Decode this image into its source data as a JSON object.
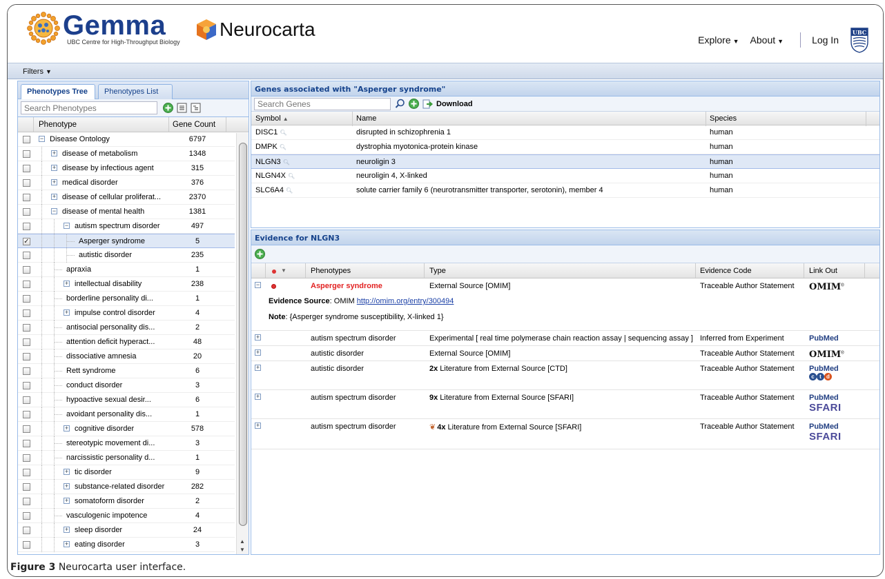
{
  "header": {
    "gemma_title": "Gemma",
    "gemma_subtitle": "UBC Centre for High-Throughput Biology",
    "neurocarta_title": "Neurocarta",
    "nav": {
      "explore": "Explore",
      "about": "About",
      "login": "Log In"
    },
    "ubc_logo_text": "UBC"
  },
  "filters_label": "Filters",
  "left": {
    "tabs": {
      "tree": "Phenotypes Tree",
      "list": "Phenotypes List"
    },
    "search_placeholder": "Search Phenotypes",
    "col_phenotype": "Phenotype",
    "col_count": "Gene Count",
    "rows": [
      {
        "label": "Disease Ontology",
        "count": "6797",
        "checked": false
      },
      {
        "label": "disease of metabolism",
        "count": "1348",
        "checked": false
      },
      {
        "label": "disease by infectious agent",
        "count": "315",
        "checked": false
      },
      {
        "label": "medical disorder",
        "count": "376",
        "checked": false
      },
      {
        "label": "disease of cellular proliferat...",
        "count": "2370",
        "checked": false
      },
      {
        "label": "disease of mental health",
        "count": "1381",
        "checked": false
      },
      {
        "label": "autism spectrum disorder",
        "count": "497",
        "checked": false
      },
      {
        "label": "Asperger syndrome",
        "count": "5",
        "checked": true
      },
      {
        "label": "autistic disorder",
        "count": "235",
        "checked": false
      },
      {
        "label": "apraxia",
        "count": "1",
        "checked": false
      },
      {
        "label": "intellectual disability",
        "count": "238",
        "checked": false
      },
      {
        "label": "borderline personality di...",
        "count": "1",
        "checked": false
      },
      {
        "label": "impulse control disorder",
        "count": "4",
        "checked": false
      },
      {
        "label": "antisocial personality dis...",
        "count": "2",
        "checked": false
      },
      {
        "label": "attention deficit hyperact...",
        "count": "48",
        "checked": false
      },
      {
        "label": "dissociative amnesia",
        "count": "20",
        "checked": false
      },
      {
        "label": "Rett syndrome",
        "count": "6",
        "checked": false
      },
      {
        "label": "conduct disorder",
        "count": "3",
        "checked": false
      },
      {
        "label": "hypoactive sexual desir...",
        "count": "6",
        "checked": false
      },
      {
        "label": "avoidant personality dis...",
        "count": "1",
        "checked": false
      },
      {
        "label": "cognitive disorder",
        "count": "578",
        "checked": false
      },
      {
        "label": "stereotypic movement di...",
        "count": "3",
        "checked": false
      },
      {
        "label": "narcissistic personality d...",
        "count": "1",
        "checked": false
      },
      {
        "label": "tic disorder",
        "count": "9",
        "checked": false
      },
      {
        "label": "substance-related disorder",
        "count": "282",
        "checked": false
      },
      {
        "label": "somatoform disorder",
        "count": "2",
        "checked": false
      },
      {
        "label": "vasculogenic impotence",
        "count": "4",
        "checked": false
      },
      {
        "label": "sleep disorder",
        "count": "24",
        "checked": false
      },
      {
        "label": "eating disorder",
        "count": "3",
        "checked": false
      }
    ]
  },
  "genes": {
    "title": "Genes associated with \"Asperger syndrome\"",
    "search_placeholder": "Search Genes",
    "download_label": "Download",
    "columns": {
      "symbol": "Symbol",
      "name": "Name",
      "species": "Species"
    },
    "rows": [
      {
        "symbol": "DISC1",
        "name": "disrupted in schizophrenia 1",
        "species": "human"
      },
      {
        "symbol": "DMPK",
        "name": "dystrophia myotonica-protein kinase",
        "species": "human"
      },
      {
        "symbol": "NLGN3",
        "name": "neuroligin 3",
        "species": "human"
      },
      {
        "symbol": "NLGN4X",
        "name": "neuroligin 4, X-linked",
        "species": "human"
      },
      {
        "symbol": "SLC6A4",
        "name": "solute carrier family 6 (neurotransmitter transporter, serotonin), member 4",
        "species": "human"
      }
    ]
  },
  "evidence": {
    "title": "Evidence for NLGN3",
    "columns": {
      "phenotypes": "Phenotypes",
      "type": "Type",
      "code": "Evidence Code",
      "link": "Link Out"
    },
    "expanded": {
      "source_label": "Evidence Source",
      "source_text": ": OMIM ",
      "source_link": "http://omim.org/entry/300494",
      "note_label": "Note",
      "note_text": ": {Asperger syndrome susceptibility, X-linked 1}"
    },
    "rows": [
      {
        "phenotype": "Asperger syndrome",
        "count_prefix": "",
        "type": "External Source [OMIM]",
        "code": "Traceable Author Statement",
        "link": "OMIM"
      },
      {
        "phenotype": "autism spectrum disorder",
        "count_prefix": "",
        "type": "Experimental [ real time polymerase chain reaction assay | sequencing assay ]",
        "code": "Inferred from Experiment",
        "link": "PubMed"
      },
      {
        "phenotype": "autistic disorder",
        "count_prefix": "",
        "type": "External Source [OMIM]",
        "code": "Traceable Author Statement",
        "link": "OMIM"
      },
      {
        "phenotype": "autistic disorder",
        "count_prefix": "2x",
        "type": " Literature from External Source [CTD]",
        "code": "Traceable Author Statement",
        "link": "PubMed"
      },
      {
        "phenotype": "autism spectrum disorder",
        "count_prefix": "9x",
        "type": " Literature from External Source [SFARI]",
        "code": "Traceable Author Statement",
        "link": "PubMed"
      },
      {
        "phenotype": "autism spectrum disorder",
        "count_prefix": "4x",
        "type": " Literature from External Source [SFARI]",
        "code": "Traceable Author Statement",
        "link": "PubMed"
      }
    ],
    "ctd_label": "ctd",
    "sfari_label": "SFARI"
  },
  "caption": {
    "bold": "Figure 3",
    "text": " Neurocarta user interface."
  },
  "colors": {
    "header_blue": "#15428b",
    "red_phenotype": "#e22222",
    "gemma_blue": "#1c3f8c"
  }
}
